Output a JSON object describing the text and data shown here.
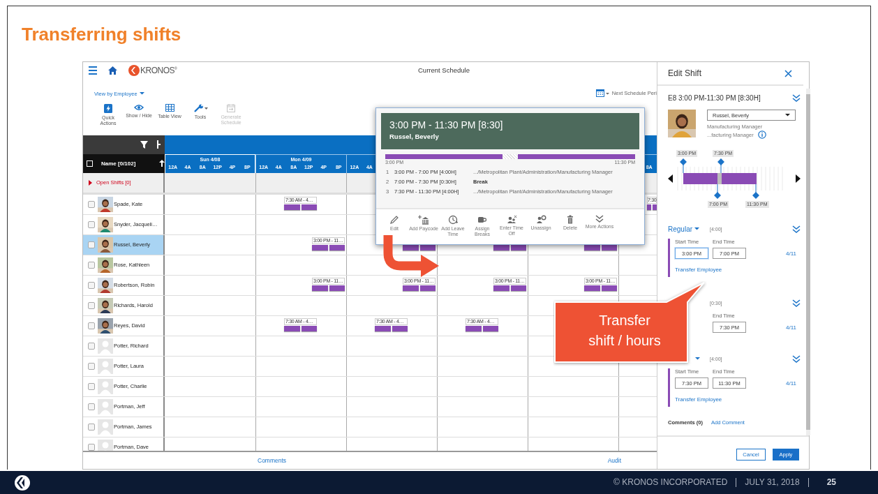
{
  "slide": {
    "title": "Transferring shifts"
  },
  "app": {
    "logo": "KRONOS$^{®}$",
    "title": "Current Schedule",
    "view_selector": "View by Employee",
    "period_link": "Next Schedule Peri",
    "toolbar": [
      {
        "label": "Quick Actions",
        "disabled": false
      },
      {
        "label": "Show / Hide",
        "disabled": false
      },
      {
        "label": "Table View",
        "disabled": false
      },
      {
        "label": "Tools",
        "disabled": false
      },
      {
        "label": "Generate Schedule",
        "disabled": true
      }
    ],
    "name_column": {
      "header": "Name [0/102]",
      "checked": false
    },
    "days": [
      {
        "label": "Sun 4/08",
        "selected": true,
        "hours": [
          "12A",
          "4A",
          "8A",
          "12P",
          "4P",
          "8P"
        ]
      },
      {
        "label": "Mon 4/09",
        "selected": false,
        "hours": [
          "12A",
          "4A",
          "8A",
          "12P",
          "4P",
          "8P"
        ]
      },
      {
        "selected": false,
        "hours": [
          "12A",
          "4A"
        ]
      },
      {
        "hours": [
          "8A"
        ]
      }
    ],
    "open_shifts": "Open Shifts [0]",
    "employees": [
      {
        "name": "Spade, Kate",
        "photo": true,
        "checked": false,
        "selected": false,
        "shifts": {
          "column_2": {
            "kind": "day",
            "label": "7:30 AM - 4…"
          },
          "column_6": {
            "kind": "day",
            "label": "7:30"
          }
        }
      },
      {
        "name": "Snyder, Jacqueli…",
        "photo": true,
        "checked": false,
        "selected": false
      },
      {
        "name": "Russel, Beverly",
        "photo": true,
        "checked": false,
        "selected": true,
        "shifts": {
          "column_2": {
            "kind": "evening",
            "label": "3:00 PM - 11…"
          },
          "column_3": {
            "kind": "evening"
          },
          "column_4": {
            "kind": "evening"
          },
          "column_5": {
            "kind": "evening"
          }
        }
      },
      {
        "name": "Rose, Kathleen",
        "photo": true,
        "checked": false,
        "selected": false
      },
      {
        "name": "Robertson, Robin",
        "photo": true,
        "checked": false,
        "selected": false,
        "shifts": {
          "column_2": {
            "kind": "evening",
            "label": "3:00 PM - 11…"
          },
          "column_3": {
            "kind": "evening",
            "label": "3:00 PM - 11…"
          },
          "column_4": {
            "kind": "evening",
            "label": "3:00 PM - 11…"
          },
          "column_5": {
            "kind": "evening",
            "label": "3:00 PM - 11…"
          }
        }
      },
      {
        "name": "Richards, Harold",
        "photo": true,
        "checked": false,
        "selected": false
      },
      {
        "name": "Reyes, David",
        "photo": true,
        "checked": false,
        "selected": false,
        "shifts": {
          "column_2": {
            "kind": "day",
            "label": "7:30 AM - 4…"
          },
          "column_3": {
            "kind": "day",
            "label": "7:30 AM - 4…"
          },
          "column_4": {
            "kind": "day",
            "label": "7:30 AM - 4…"
          }
        }
      },
      {
        "name": "Potter, Richard",
        "photo": false,
        "checked": false,
        "selected": false
      },
      {
        "name": "Potter, Laura",
        "photo": false,
        "checked": false,
        "selected": false
      },
      {
        "name": "Potter, Charlie",
        "photo": false,
        "checked": false,
        "selected": false
      },
      {
        "name": "Portman, Jeff",
        "photo": false,
        "checked": false,
        "selected": false
      },
      {
        "name": "Portman, James",
        "photo": false,
        "checked": false,
        "selected": false
      },
      {
        "name": "Portman, Dave",
        "photo": false,
        "checked": false,
        "selected": false
      }
    ],
    "footer_links": [
      "Comments",
      "Audit"
    ]
  },
  "shift_popup": {
    "title": "3:00 PM - 11:30 PM [8:30]",
    "employee": "Russel, Beverly",
    "start": "3:00 PM",
    "end": "11:30 PM",
    "segments": [
      {
        "index": "1",
        "kind": "work",
        "time": "3:00 PM - 7:00 PM [4:00H]",
        "detail": ".../Metropolitan Plant/Administration/Manufacturing Manager"
      },
      {
        "index": "2",
        "kind": "break",
        "time": "7:00 PM - 7:30 PM [0:30H]",
        "detail": "Break"
      },
      {
        "index": "3",
        "kind": "work",
        "time": "7:30 PM - 11:30 PM [4:00H]",
        "detail": ".../Metropolitan Plant/Administration/Manufacturing Manager"
      }
    ],
    "actions": [
      "Edit",
      "Add Paycode",
      "Add Leave Time",
      "Assign Breaks",
      "Enter Time Off",
      "Unassign",
      "Delete",
      "More Actions"
    ]
  },
  "edit_shift": {
    "title": "Edit Shift",
    "summary": "E8 3:00 PM-11:30 PM [8:30H]",
    "employee": "Russel, Beverly",
    "job": "Manufacturing Manager",
    "job_path": "...facturing Manager",
    "timeline": {
      "top_labels": [
        "3:00 PM",
        "7:30 PM"
      ],
      "bottom_labels": [
        "7:00 PM",
        "11:30 PM"
      ]
    },
    "segments": [
      {
        "kind": "work",
        "type": "Regular",
        "duration": "[4:00]",
        "start_label": "Start Time",
        "start": "3:00 PM",
        "end_label": "End Time",
        "end": "7:00 PM",
        "date": "4/11",
        "link": "Transfer Employee",
        "focused": true
      },
      {
        "kind": "break",
        "duration": "[0:30]",
        "end_label": "End Time",
        "end": "7:30 PM",
        "date": "4/11"
      },
      {
        "kind": "work",
        "duration": "[4:00]",
        "start_label": "Start Time",
        "start": "7:30 PM",
        "end_label": "End Time",
        "end": "11:30 PM",
        "date": "4/11",
        "link": "Transfer Employee",
        "focused": false
      }
    ],
    "comments": "Comments (0)",
    "add_comment": "Add Comment",
    "buttons": [
      {
        "label": "Cancel",
        "kind": "secondary"
      },
      {
        "label": "Apply",
        "kind": "primary"
      }
    ]
  },
  "callout": {
    "text": "Transfer\nshift / hours"
  },
  "footer": {
    "company": "© KRONOS INCORPORATED",
    "date": "JULY 31, 2018",
    "page": "25"
  }
}
